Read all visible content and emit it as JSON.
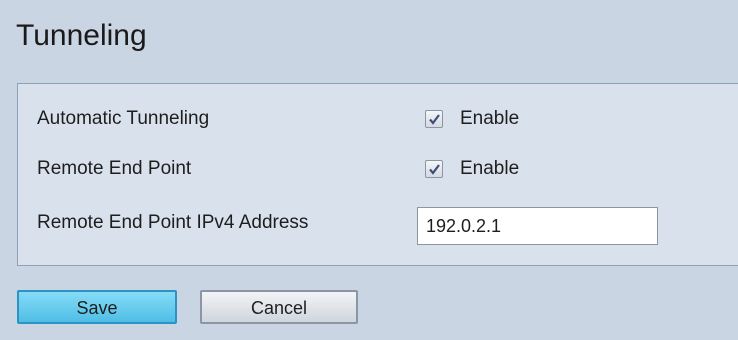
{
  "page": {
    "title": "Tunneling"
  },
  "form": {
    "automatic_tunneling": {
      "label": "Automatic Tunneling",
      "checkbox_label": "Enable",
      "checked": true
    },
    "remote_end_point": {
      "label": "Remote End Point",
      "checkbox_label": "Enable",
      "checked": true
    },
    "remote_ipv4": {
      "label": "Remote End Point IPv4 Address",
      "value": "192.0.2.1"
    }
  },
  "buttons": {
    "save_label": "Save",
    "cancel_label": "Cancel"
  }
}
